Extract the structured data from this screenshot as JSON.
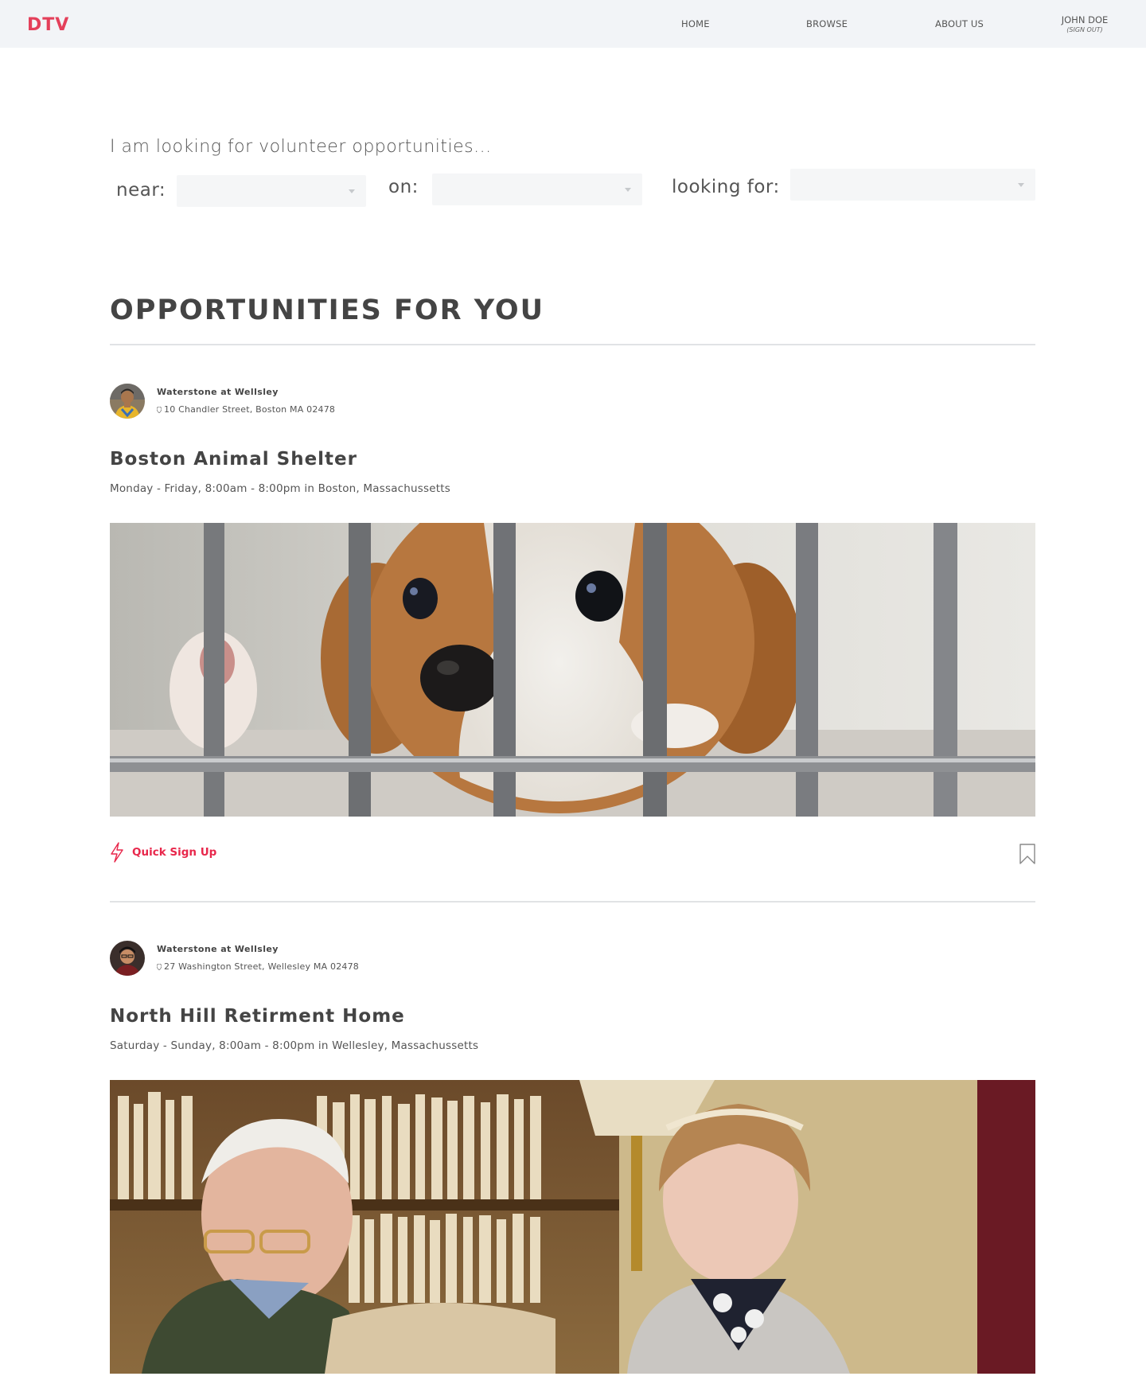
{
  "header": {
    "logo": "DTV",
    "nav": {
      "home": "HOME",
      "browse": "BROWSE",
      "about": "ABOUT US"
    },
    "user": {
      "name": "JOHN DOE",
      "signout": "(SIGN OUT)"
    }
  },
  "search": {
    "intro": "I am looking for volunteer opportunities...",
    "near_label": "near:",
    "on_label": "on:",
    "for_label": "looking for:",
    "near_value": "",
    "on_value": "",
    "for_value": ""
  },
  "section": {
    "title": "OPPORTUNITIES FOR YOU"
  },
  "opportunities": [
    {
      "org_name": "Waterstone at Wellsley",
      "address": "10 Chandler Street, Boston MA 02478",
      "title": "Boston Animal Shelter",
      "schedule": "Monday - Friday, 8:00am - 8:00pm in Boston, Massachussetts",
      "image": "puppy-behind-cage-bars",
      "quick_signup": "Quick Sign Up"
    },
    {
      "org_name": "Waterstone at Wellsley",
      "address": "27 Washington Street, Wellesley MA 02478",
      "title": "North Hill Retirment Home",
      "schedule": "Saturday - Sunday, 8:00am - 8:00pm in Wellesley, Massachussetts",
      "image": "elderly-couple-in-library"
    }
  ],
  "icons": {
    "quick_signup": "lightning-bolt-icon",
    "bookmark": "bookmark-icon",
    "address": "location-pin-icon"
  },
  "colors": {
    "brand": "#e43f5a",
    "accent": "#e8274b",
    "header_bg": "#f2f4f7",
    "text": "#444444"
  }
}
